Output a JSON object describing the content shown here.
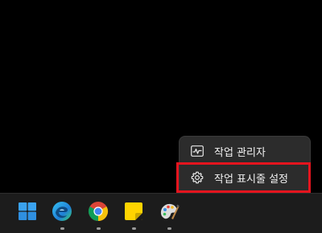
{
  "context_menu": {
    "items": [
      {
        "label": "작업 관리자",
        "icon": "task-manager-icon"
      },
      {
        "label": "작업 표시줄 설정",
        "icon": "gear-icon"
      }
    ]
  },
  "taskbar": {
    "apps": [
      {
        "name": "start",
        "icon": "windows-logo-icon"
      },
      {
        "name": "edge",
        "icon": "edge-icon"
      },
      {
        "name": "chrome",
        "icon": "chrome-icon"
      },
      {
        "name": "sticky-notes",
        "icon": "sticky-notes-icon"
      },
      {
        "name": "paint",
        "icon": "paint-palette-icon"
      }
    ]
  },
  "colors": {
    "highlight": "#e5141e",
    "menu_bg": "#2c2c2c",
    "taskbar_bg": "#1c1c1c"
  }
}
